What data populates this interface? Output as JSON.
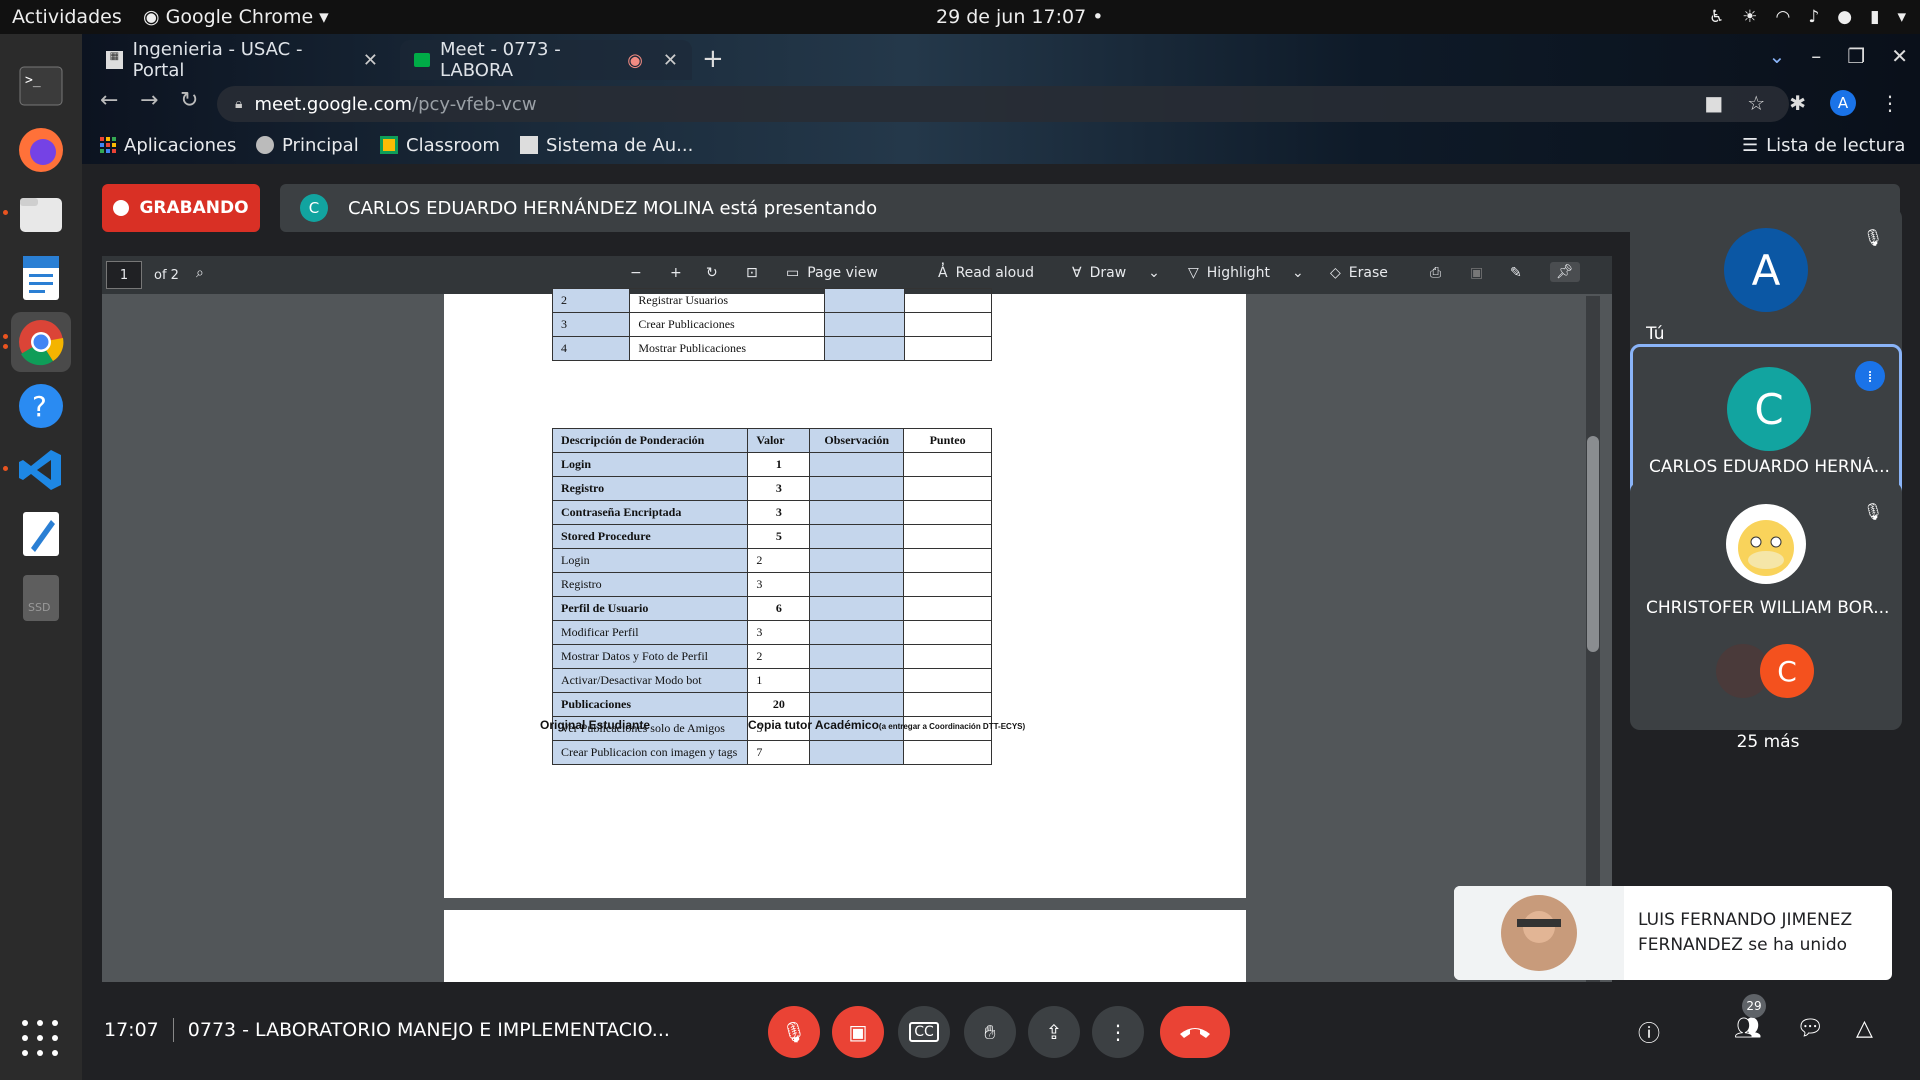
{
  "gnome": {
    "activities": "Actividades",
    "app_name": "Google Chrome",
    "clock": "29 de jun  17:07"
  },
  "chrome": {
    "tabs": [
      {
        "label": "Ingenieria - USAC - Portal"
      },
      {
        "label": "Meet - 0773 - LABORA"
      }
    ],
    "url_host": "meet.google.com",
    "url_path": "/pcy-vfeb-vcw",
    "profile_initial": "A",
    "bookmarks": [
      "Aplicaciones",
      "Principal",
      "Classroom",
      "Sistema de Au..."
    ],
    "reading_list": "Lista de lectura"
  },
  "meet": {
    "recording_label": "GRABANDO",
    "presenter_initial": "C",
    "presenting_text": "CARLOS EDUARDO HERNÁNDEZ MOLINA está presentando",
    "meeting_time": "17:07",
    "meeting_name": "0773 - LABORATORIO MANEJO E IMPLEMENTACIO...",
    "participant_count": "29",
    "participants": [
      {
        "initial": "A",
        "name": "Tú",
        "color": "#0b57a4"
      },
      {
        "initial": "C",
        "name": "CARLOS EDUARDO HERNÁ...",
        "color": "#12a4a0"
      },
      {
        "initial": "",
        "name": "CHRISTOFER WILLIAM BOR...",
        "color": "#ffffff"
      },
      {
        "initial": "C",
        "name": "25 más",
        "color": "#f4511e"
      }
    ],
    "toast": {
      "line1": "LUIS FERNANDO JIMENEZ",
      "line2": "FERNANDEZ se ha unido"
    }
  },
  "pdf": {
    "page_number": "1",
    "page_total": "of 2",
    "toolbar": {
      "page_view": "Page view",
      "read_aloud": "Read aloud",
      "draw": "Draw",
      "highlight": "Highlight",
      "erase": "Erase"
    },
    "top_table": [
      {
        "num": "2",
        "desc": "Registrar Usuarios"
      },
      {
        "num": "3",
        "desc": "Crear Publicaciones"
      },
      {
        "num": "4",
        "desc": "Mostrar Publicaciones"
      }
    ],
    "main_table": {
      "headers": [
        "Descripción de Ponderación",
        "Valor",
        "Observación",
        "Punteo"
      ],
      "rows": [
        {
          "desc": "Login",
          "valor": "1",
          "bold": true
        },
        {
          "desc": "Registro",
          "valor": "3",
          "bold": true
        },
        {
          "desc": "Contraseña Encriptada",
          "valor": "3",
          "bold": true
        },
        {
          "desc": "Stored Procedure",
          "valor": "5",
          "bold": true
        },
        {
          "desc": "Login",
          "valor": "2",
          "bold": false
        },
        {
          "desc": "Registro",
          "valor": "3",
          "bold": false
        },
        {
          "desc": "Perfil de Usuario",
          "valor": "6",
          "bold": true
        },
        {
          "desc": "Modificar Perfil",
          "valor": "3",
          "bold": false
        },
        {
          "desc": "Mostrar Datos y Foto de Perfil",
          "valor": "2",
          "bold": false
        },
        {
          "desc": "Activar/Desactivar Modo bot",
          "valor": "1",
          "bold": false
        },
        {
          "desc": "Publicaciones",
          "valor": "20",
          "bold": true
        },
        {
          "desc": "Ver Publicaciones solo de Amigos",
          "valor": "5",
          "bold": false
        },
        {
          "desc": "Crear Publicacion con imagen y tags",
          "valor": "7",
          "bold": false
        }
      ]
    },
    "footer_left": "Original Estudiante",
    "footer_right": "Copia tutor Académico",
    "footer_right_small": "(a entregar a Coordinación DTT-ECYS)"
  }
}
